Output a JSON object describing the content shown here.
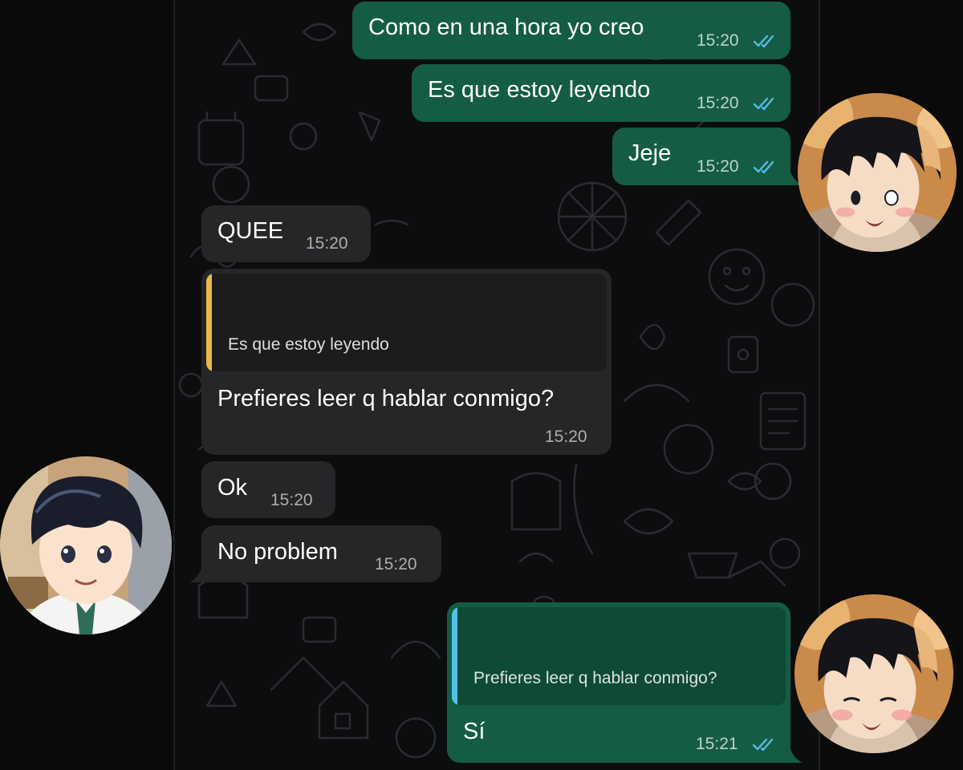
{
  "theme": {
    "outgoing_bubble": "#155c45",
    "incoming_bubble": "#242628",
    "read_tick": "#53bdeb",
    "quote_bar_incoming": "#e9b94a",
    "quote_bar_outgoing": "#54c2e8"
  },
  "messages": [
    {
      "direction": "outgoing",
      "text": "Como en una hora yo creo",
      "time": "15:20",
      "status": "read"
    },
    {
      "direction": "outgoing",
      "text": "Es que estoy leyendo",
      "time": "15:20",
      "status": "read"
    },
    {
      "direction": "outgoing",
      "text": "Jeje",
      "time": "15:20",
      "status": "read"
    },
    {
      "direction": "incoming",
      "text": "QUEE",
      "time": "15:20"
    },
    {
      "direction": "incoming",
      "quoted": "Es que estoy leyendo",
      "text": "Prefieres leer q hablar conmigo?",
      "time": "15:20"
    },
    {
      "direction": "incoming",
      "text": "Ok",
      "time": "15:20"
    },
    {
      "direction": "incoming",
      "text": "No problem",
      "time": "15:20"
    },
    {
      "direction": "outgoing",
      "quoted": "Prefieres leer q hablar conmigo?",
      "text": "Sí",
      "time": "15:21",
      "status": "read"
    }
  ],
  "avatars": [
    {
      "side": "right",
      "icon": "anime-boy-blushing-avatar-icon"
    },
    {
      "side": "left",
      "icon": "anime-boy-smiling-avatar-icon"
    },
    {
      "side": "right",
      "icon": "anime-boy-blushing-avatar-icon"
    }
  ]
}
